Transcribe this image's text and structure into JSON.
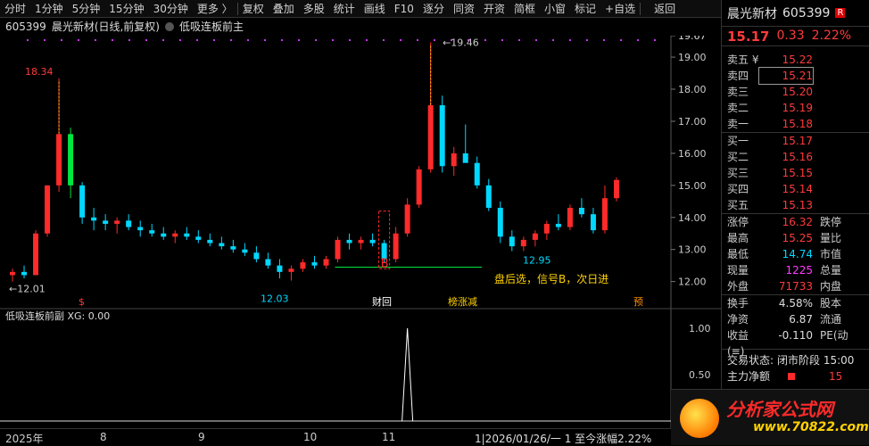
{
  "toolbar": {
    "items": [
      "分时",
      "1分钟",
      "5分钟",
      "15分钟",
      "30分钟",
      "更多 〉",
      "复权",
      "叠加",
      "多股",
      "统计",
      "画线",
      "F10",
      "逐分",
      "同资",
      "开资",
      "简框",
      "小窗",
      "标记",
      "+自选",
      "返回"
    ]
  },
  "title": {
    "code": "605399",
    "name": "晨光新材(日线,前复权)",
    "indicator": "低吸连板前主"
  },
  "chart": {
    "y_ticks": [
      "19.67",
      "19.00",
      "18.00",
      "17.00",
      "16.00",
      "15.00",
      "14.00",
      "13.00",
      "12.00"
    ],
    "annotations": {
      "high_left": "18.34",
      "low_left": "12.01",
      "low_mid": "12.03",
      "high_peak": "19.46",
      "low_right": "12.95",
      "signal": "B",
      "note": "盘后选，信号B，次日进"
    },
    "event_tags": [
      "$",
      "财回",
      "榜涨减",
      "预"
    ],
    "sub_title": "低吸连板前副",
    "sub_value": "XG: 0.00",
    "sub_ticks": [
      "1.00",
      "0.50"
    ],
    "x_labels": [
      "2025年",
      "8",
      "9",
      "10",
      "11"
    ],
    "status_bar": "1|2026/01/26/一 1 至今涨幅2.22%"
  },
  "chart_data": {
    "type": "candlestick",
    "title": "晨光新材(日线,前复权)",
    "ylim": [
      11.6,
      19.67
    ],
    "x_labels": [
      "2025年",
      "8",
      "9",
      "10",
      "11"
    ],
    "candles": [
      [
        12.2,
        12.4,
        12.0,
        12.3
      ],
      [
        12.3,
        12.5,
        12.1,
        12.2
      ],
      [
        12.2,
        13.6,
        12.2,
        13.5
      ],
      [
        13.5,
        14.6,
        13.4,
        15.0
      ],
      [
        15.0,
        18.34,
        14.8,
        16.6
      ],
      [
        16.6,
        16.8,
        14.6,
        15.0
      ],
      [
        15.0,
        15.1,
        13.8,
        14.0
      ],
      [
        14.0,
        14.3,
        13.6,
        13.9
      ],
      [
        13.9,
        14.1,
        13.6,
        13.8
      ],
      [
        13.8,
        14.0,
        13.5,
        13.9
      ],
      [
        13.9,
        14.1,
        13.6,
        13.7
      ],
      [
        13.7,
        13.9,
        13.4,
        13.6
      ],
      [
        13.6,
        13.8,
        13.4,
        13.5
      ],
      [
        13.5,
        13.7,
        13.3,
        13.4
      ],
      [
        13.4,
        13.6,
        13.2,
        13.5
      ],
      [
        13.5,
        13.7,
        13.3,
        13.4
      ],
      [
        13.4,
        13.6,
        13.2,
        13.3
      ],
      [
        13.3,
        13.5,
        13.1,
        13.2
      ],
      [
        13.2,
        13.4,
        13.0,
        13.1
      ],
      [
        13.1,
        13.3,
        12.9,
        13.0
      ],
      [
        13.0,
        13.2,
        12.8,
        12.9
      ],
      [
        12.9,
        13.1,
        12.6,
        12.7
      ],
      [
        12.7,
        12.9,
        12.4,
        12.5
      ],
      [
        12.5,
        12.7,
        12.1,
        12.3
      ],
      [
        12.3,
        12.5,
        12.03,
        12.4
      ],
      [
        12.4,
        12.7,
        12.3,
        12.6
      ],
      [
        12.6,
        12.8,
        12.4,
        12.5
      ],
      [
        12.5,
        12.8,
        12.4,
        12.7
      ],
      [
        12.7,
        13.4,
        12.6,
        13.3
      ],
      [
        13.3,
        13.5,
        13.0,
        13.2
      ],
      [
        13.2,
        13.4,
        13.0,
        13.3
      ],
      [
        13.3,
        13.5,
        13.1,
        13.2
      ],
      [
        13.2,
        13.3,
        12.6,
        12.7
      ],
      [
        12.7,
        13.7,
        12.6,
        13.5
      ],
      [
        13.5,
        14.6,
        13.4,
        14.4
      ],
      [
        14.4,
        15.6,
        14.3,
        15.5
      ],
      [
        15.5,
        19.46,
        15.4,
        17.5
      ],
      [
        17.5,
        17.8,
        15.4,
        15.6
      ],
      [
        15.6,
        16.2,
        15.3,
        16.0
      ],
      [
        16.0,
        16.9,
        15.8,
        15.7
      ],
      [
        15.7,
        15.9,
        14.9,
        15.0
      ],
      [
        15.0,
        15.2,
        14.2,
        14.3
      ],
      [
        14.3,
        14.5,
        13.2,
        13.4
      ],
      [
        13.4,
        13.6,
        12.95,
        13.1
      ],
      [
        13.1,
        13.4,
        12.95,
        13.3
      ],
      [
        13.3,
        13.6,
        13.1,
        13.5
      ],
      [
        13.5,
        13.9,
        13.3,
        13.8
      ],
      [
        13.8,
        14.1,
        13.6,
        13.7
      ],
      [
        13.7,
        14.4,
        13.6,
        14.3
      ],
      [
        14.3,
        14.6,
        14.0,
        14.1
      ],
      [
        14.1,
        14.3,
        13.5,
        13.6
      ],
      [
        13.6,
        15.0,
        13.5,
        14.6
      ],
      [
        14.6,
        15.25,
        14.5,
        15.17
      ]
    ],
    "sub_series": {
      "name": "XG",
      "spike_index": 34,
      "ylim": [
        0,
        1.0
      ]
    }
  },
  "quote": {
    "name": "晨光新材",
    "code": "605399",
    "badge": "R",
    "price": "15.17",
    "change": "0.33",
    "pct": "2.22%",
    "asks": [
      [
        "卖五 ¥",
        "15.22"
      ],
      [
        "卖四",
        "15.21"
      ],
      [
        "卖三",
        "15.20"
      ],
      [
        "卖二",
        "15.19"
      ],
      [
        "卖一",
        "15.18"
      ]
    ],
    "bids": [
      [
        "买一",
        "15.17"
      ],
      [
        "买二",
        "15.16"
      ],
      [
        "买三",
        "15.15"
      ],
      [
        "买四",
        "15.14"
      ],
      [
        "买五",
        "15.13"
      ]
    ],
    "stats": [
      [
        "涨停",
        "16.32",
        "跌停"
      ],
      [
        "最高",
        "15.25",
        "量比"
      ],
      [
        "最低",
        "14.74",
        "市值"
      ],
      [
        "现量",
        "1225",
        "总量"
      ],
      [
        "外盘",
        "71733",
        "内盘"
      ]
    ],
    "stats2": [
      [
        "换手",
        "4.58%",
        "股本"
      ],
      [
        "净资",
        "6.87",
        "流通"
      ],
      [
        "收益(≡)",
        "-0.110",
        "PE(动"
      ]
    ],
    "trade_state_label": "交易状态:",
    "trade_state": "闭市阶段 15:00",
    "main_flow_label": "主力净额",
    "main_flow": "15"
  },
  "brand": {
    "cn": "分析家公式网",
    "url": "www.70822.com"
  },
  "watermark": "分析家公式网www.70822.com"
}
